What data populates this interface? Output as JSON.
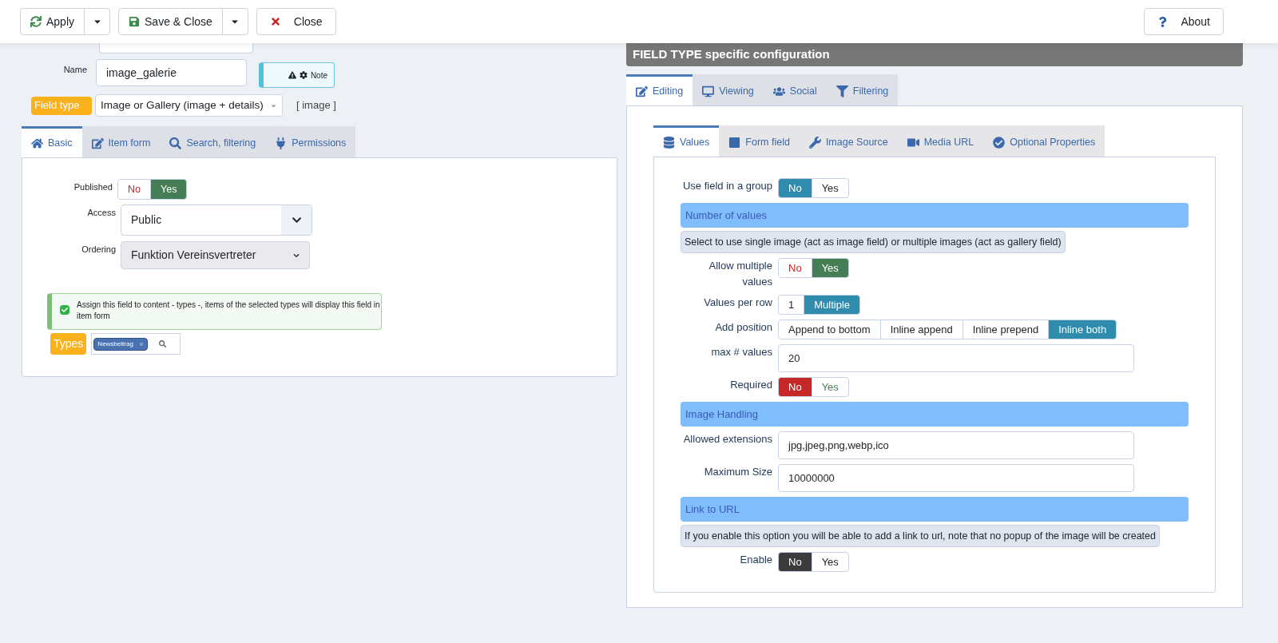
{
  "toolbar": {
    "buttons": [
      {
        "label": "Apply",
        "kind": "split"
      },
      {
        "label": "Save & Close",
        "kind": "split"
      },
      {
        "label": "Close",
        "kind": "plain"
      }
    ],
    "about": "About"
  },
  "left": {
    "name_label": "Name",
    "name_value": "image_galerie",
    "note": "Note",
    "field_type_label": "Field type",
    "field_type_value": "Image or Gallery (image + details)",
    "field_type_code": "[ image ]",
    "tabs": [
      {
        "label": "Basic",
        "selected": true
      },
      {
        "label": "Item form",
        "selected": false
      },
      {
        "label": "Search, filtering",
        "selected": false
      },
      {
        "label": "Permissions",
        "selected": false
      }
    ],
    "published": {
      "label": "Published",
      "options": [
        {
          "label": "No",
          "color": "#c52827",
          "selected": false
        },
        {
          "label": "Yes",
          "color": "#457d54",
          "selected": true
        }
      ]
    },
    "access": {
      "label": "Access",
      "value": "Public"
    },
    "ordering": {
      "label": "Ordering",
      "value": "Funktion Vereinsvertreter"
    },
    "assign": {
      "text": "Assign this field to content - types -, items of the selected types will display this field in item form",
      "checked": true
    },
    "types": {
      "label": "Types",
      "tags": [
        "Newsbeitrag"
      ]
    }
  },
  "right": {
    "header": "FIELD TYPE specific configuration",
    "tabs": [
      {
        "label": "Editing",
        "selected": true
      },
      {
        "label": "Viewing",
        "selected": false
      },
      {
        "label": "Social",
        "selected": false
      },
      {
        "label": "Filtering",
        "selected": false
      }
    ],
    "inner_tabs": [
      {
        "label": "Values",
        "selected": true
      },
      {
        "label": "Form field",
        "selected": false
      },
      {
        "label": "Image Source",
        "selected": false
      },
      {
        "label": "Media URL",
        "selected": false
      },
      {
        "label": "Optional Properties",
        "selected": false
      }
    ],
    "rows": [
      {
        "kind": "toggle",
        "label": "Use field in a group",
        "options": [
          {
            "label": "No",
            "color": "#2f8cad",
            "selected": true
          },
          {
            "label": "Yes",
            "color": "#22262a",
            "selected": false
          }
        ]
      },
      {
        "kind": "heading",
        "text": "Number of values"
      },
      {
        "kind": "hint",
        "text": "Select to use single image (act as image field) or multiple images (act as gallery field)"
      },
      {
        "kind": "toggle",
        "label": "Allow multiple values",
        "options": [
          {
            "label": "No",
            "color": "#c52827",
            "selected": false
          },
          {
            "label": "Yes",
            "color": "#457d54",
            "selected": true
          }
        ]
      },
      {
        "kind": "toggle",
        "label": "Values per row",
        "options": [
          {
            "label": "1",
            "color": "#22262a",
            "selected": false
          },
          {
            "label": "Multiple",
            "color": "#2f8cad",
            "selected": true
          }
        ]
      },
      {
        "kind": "toggle",
        "label": "Add position",
        "options": [
          {
            "label": "Append to bottom",
            "color": "#22262a",
            "selected": false
          },
          {
            "label": "Inline append",
            "color": "#22262a",
            "selected": false
          },
          {
            "label": "Inline prepend",
            "color": "#22262a",
            "selected": false
          },
          {
            "label": "Inline both",
            "color": "#2f8cad",
            "selected": true
          }
        ]
      },
      {
        "kind": "input",
        "label": "max # values",
        "value": "20"
      },
      {
        "kind": "toggle",
        "label": "Required",
        "options": [
          {
            "label": "No",
            "color": "#c52827",
            "selected": true
          },
          {
            "label": "Yes",
            "color": "#457d54",
            "selected": false
          }
        ]
      },
      {
        "kind": "heading",
        "text": "Image Handling"
      },
      {
        "kind": "input",
        "label": "Allowed extensions",
        "value": "jpg,jpeg,png,webp,ico"
      },
      {
        "kind": "input",
        "label": "Maximum Size",
        "value": "10000000"
      },
      {
        "kind": "heading",
        "text": "Link to URL"
      },
      {
        "kind": "hint",
        "text": "If you enable this option you will be able to add a link to url, note that no popup of the image will be created"
      },
      {
        "kind": "toggle",
        "label": "Enable",
        "options": [
          {
            "label": "No",
            "color": "#3b3b3b",
            "selected": true
          },
          {
            "label": "Yes",
            "color": "#22262a",
            "selected": false
          }
        ]
      }
    ]
  }
}
